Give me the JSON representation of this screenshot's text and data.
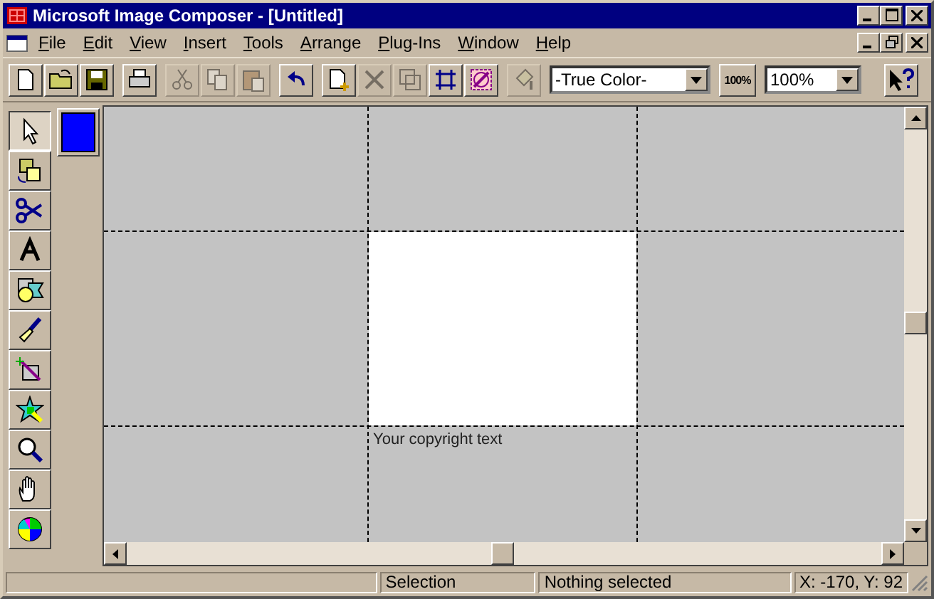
{
  "window": {
    "title": "Microsoft Image Composer - [Untitled]"
  },
  "menu": [
    {
      "accel": "F",
      "rest": "ile"
    },
    {
      "accel": "E",
      "rest": "dit"
    },
    {
      "accel": "V",
      "rest": "iew"
    },
    {
      "accel": "I",
      "rest": "nsert"
    },
    {
      "accel": "T",
      "rest": "ools"
    },
    {
      "accel": "A",
      "rest": "rrange"
    },
    {
      "accel": "P",
      "rest": "lug-Ins"
    },
    {
      "accel": "W",
      "rest": "indow"
    },
    {
      "accel": "H",
      "rest": "elp"
    }
  ],
  "toolbar": {
    "groups": [
      [
        {
          "disabled": false
        },
        {
          "disabled": false
        },
        {
          "disabled": false
        }
      ],
      [
        {
          "disabled": false
        }
      ],
      [
        {
          "disabled": true
        },
        {
          "disabled": true
        },
        {
          "disabled": true
        }
      ],
      [
        {
          "disabled": false
        }
      ],
      [
        {
          "disabled": false
        },
        {
          "disabled": true
        },
        {
          "disabled": true
        },
        {
          "disabled": false
        },
        {
          "disabled": false
        }
      ],
      [
        {
          "disabled": true
        }
      ]
    ],
    "color_mode": "-True Color-",
    "zoom_button": "100%",
    "zoom": "100%"
  },
  "tools": [
    {
      "selected": true
    },
    {
      "selected": false
    },
    {
      "selected": false
    },
    {
      "selected": false
    },
    {
      "selected": false
    },
    {
      "selected": false
    },
    {
      "selected": false
    },
    {
      "selected": false
    },
    {
      "selected": false
    },
    {
      "selected": false
    },
    {
      "selected": false
    }
  ],
  "color_swatch": {
    "color": "#0000ff"
  },
  "canvas": {
    "copyright": "Your copyright text"
  },
  "status_bar": [
    "Selection",
    "Nothing selected",
    "X: -170, Y: 92"
  ]
}
